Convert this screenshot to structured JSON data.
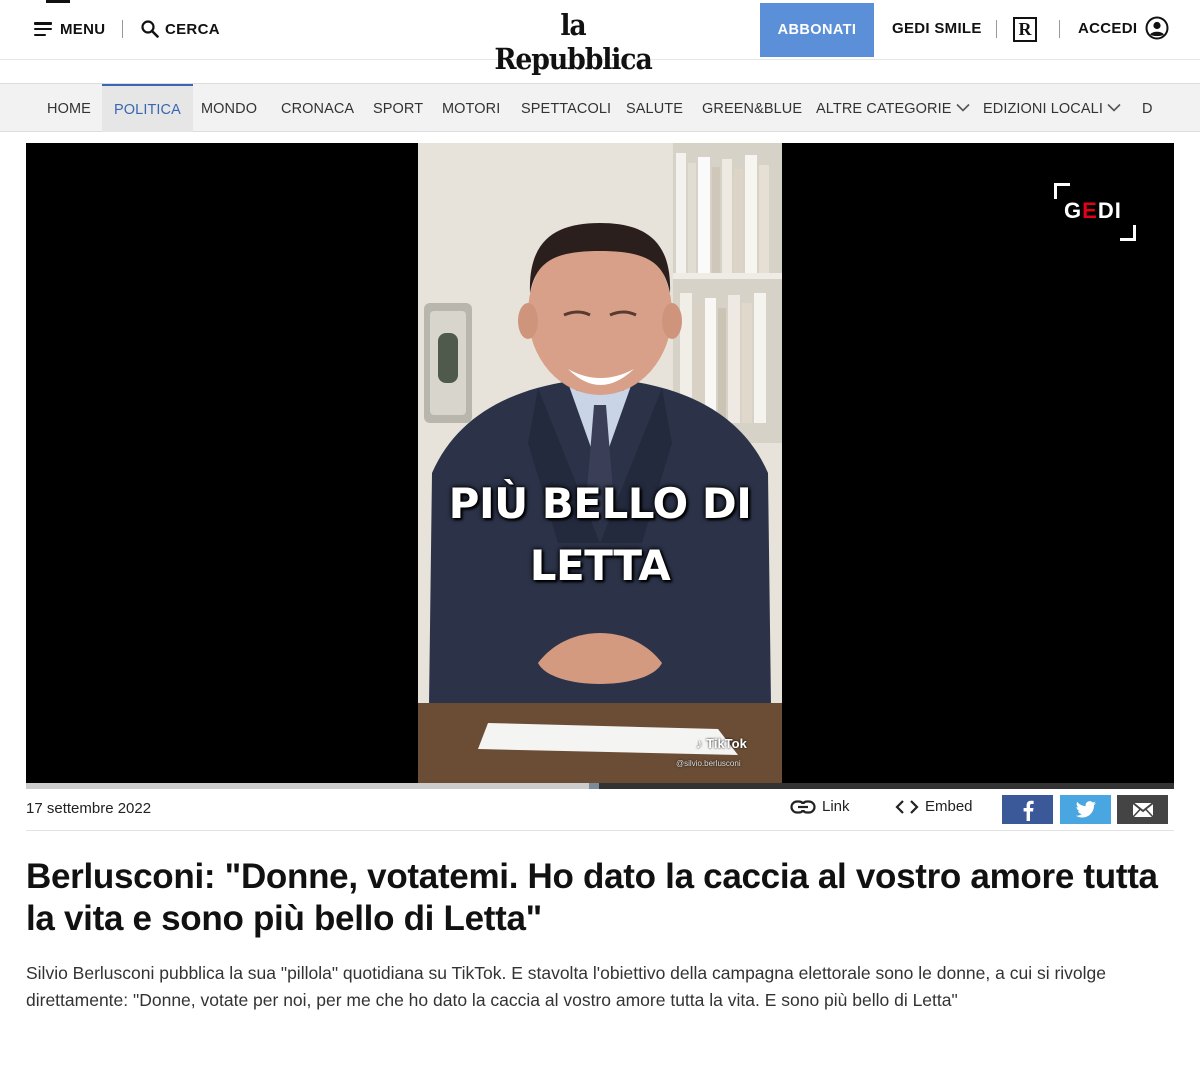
{
  "header": {
    "menu_label": "MENU",
    "search_label": "CERCA",
    "logo_text": "la Repubblica",
    "subscribe_label": "ABBONATI",
    "gedi_smile_label": "GEDI SMILE",
    "rep_icon_letter": "R",
    "login_label": "ACCEDI"
  },
  "nav": {
    "items": [
      {
        "label": "HOME"
      },
      {
        "label": "POLITICA",
        "active": true
      },
      {
        "label": "MONDO"
      },
      {
        "label": "CRONACA"
      },
      {
        "label": "SPORT"
      },
      {
        "label": "MOTORI"
      },
      {
        "label": "SPETTACOLI"
      },
      {
        "label": "SALUTE"
      },
      {
        "label": "GREEN&BLUE"
      },
      {
        "label": "ALTRE CATEGORIE",
        "has_dropdown": true
      },
      {
        "label": "EDIZIONI LOCALI",
        "has_dropdown": true
      },
      {
        "label": "D"
      }
    ],
    "active_color": "#3a66b3"
  },
  "video": {
    "caption_line1": "PIÙ BELLO DI",
    "caption_line2": "LETTA",
    "watermark_brand": "TikTok",
    "watermark_user": "@silvio.berlusconi",
    "corner_logo_prefix": "G",
    "corner_logo_accent": "E",
    "corner_logo_suffix": "DI",
    "progress_fraction": 0.49
  },
  "meta": {
    "date": "17 settembre 2022",
    "link_label": "Link",
    "embed_label": "Embed",
    "share_icons": [
      "facebook-icon",
      "twitter-icon",
      "email-icon"
    ]
  },
  "article": {
    "headline": "Berlusconi: \"Donne, votatemi. Ho dato la caccia al vostro amore tutta la vita e sono più bello di Letta\"",
    "summary": "Silvio Berlusconi pubblica la sua \"pillola\" quotidiana su TikTok. E stavolta l'obiettivo della campagna elettorale sono le donne, a cui si rivolge direttamente: \"Donne, votate per noi, per me che ho dato la caccia al vostro amore tutta la vita. E sono più bello di Letta\""
  },
  "colors": {
    "subscribe_bg": "#5b8fd8",
    "facebook": "#3b5998",
    "twitter": "#4aa6e0",
    "email": "#444444"
  }
}
